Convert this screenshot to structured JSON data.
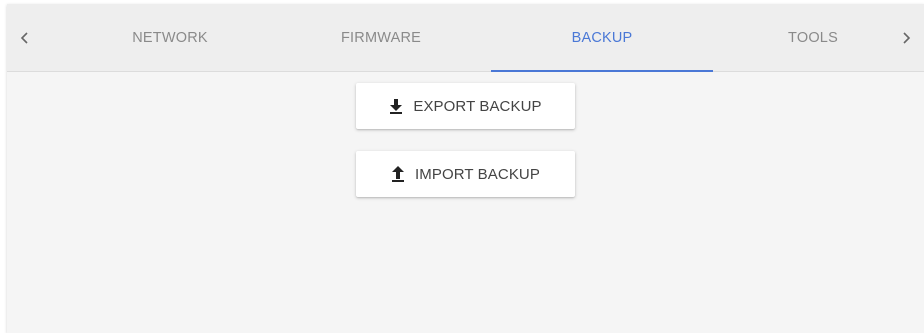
{
  "tabs": {
    "items": [
      {
        "label": "NETWORK",
        "active": false
      },
      {
        "label": "FIRMWARE",
        "active": false
      },
      {
        "label": "BACKUP",
        "active": true
      },
      {
        "label": "TOOLS",
        "active": false
      }
    ],
    "prev_icon": "chevron-left-icon",
    "next_icon": "chevron-right-icon"
  },
  "actions": {
    "export_label": "EXPORT BACKUP",
    "export_icon": "download-icon",
    "import_label": "IMPORT BACKUP",
    "import_icon": "upload-icon"
  },
  "colors": {
    "accent": "#4a78d6",
    "tab_bar": "#eeeeee",
    "panel": "#f5f5f5",
    "inactive_text": "#8a8a8a",
    "button_text": "#444444"
  }
}
